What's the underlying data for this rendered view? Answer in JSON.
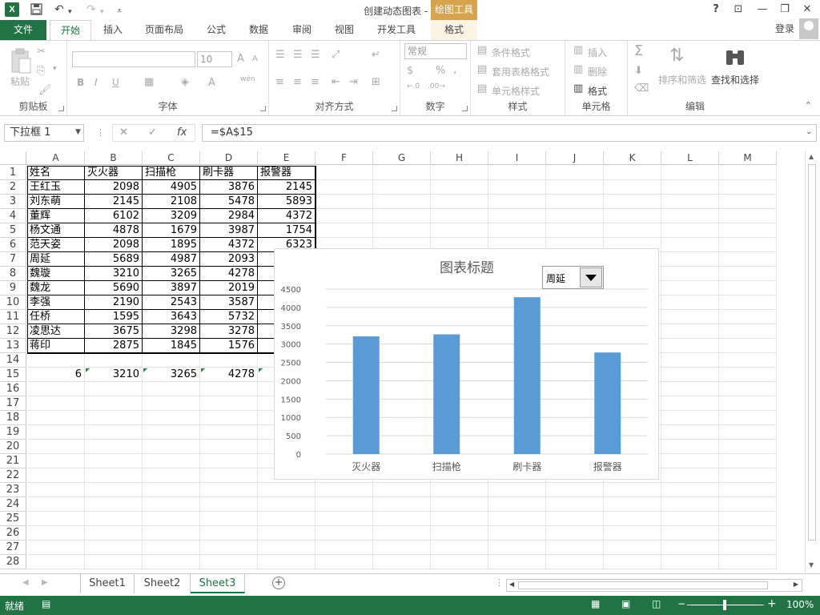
{
  "title": {
    "app_logo": "X",
    "window_title": "创建动态图表 - Excel",
    "context_tab_group": "绘图工具",
    "help": "?",
    "ribbon_options": "⊡",
    "minimize": "—",
    "restore": "❐",
    "close": "✕"
  },
  "quick_access": {
    "save_icon": "floppy-disk-icon",
    "undo": "↶",
    "redo": "↷",
    "customize": "⩡"
  },
  "tabs": [
    "文件",
    "开始",
    "插入",
    "页面布局",
    "公式",
    "数据",
    "审阅",
    "视图",
    "开发工具",
    "格式"
  ],
  "user": {
    "login": "登录"
  },
  "ribbon": {
    "clipboard": {
      "label": "剪贴板",
      "paste": "粘贴"
    },
    "font": {
      "label": "字体",
      "font_name": "",
      "font_size": "10",
      "bold": "B",
      "italic": "I",
      "underline": "U",
      "grow": "A",
      "shrink": "A",
      "font_color": "A",
      "phonetic": "wén"
    },
    "alignment": {
      "label": "对齐方式"
    },
    "number": {
      "label": "数字",
      "format": "常规",
      "percent": "%",
      "comma": ","
    },
    "styles": {
      "label": "样式",
      "conditional": "条件格式",
      "table": "套用表格格式",
      "cell_styles": "单元格样式"
    },
    "cells": {
      "label": "单元格",
      "insert": "插入",
      "delete": "删除",
      "format": "格式"
    },
    "editing": {
      "label": "编辑",
      "sort": "排序和筛选",
      "find": "查找和选择"
    }
  },
  "formula_bar": {
    "name_box": "下拉框 1",
    "fx": "fx",
    "formula": "=$A$15"
  },
  "columns": [
    "A",
    "B",
    "C",
    "D",
    "E",
    "F",
    "G",
    "H",
    "I",
    "J",
    "K",
    "L",
    "M"
  ],
  "rows": [
    "1",
    "2",
    "3",
    "4",
    "5",
    "6",
    "7",
    "8",
    "9",
    "10",
    "11",
    "12",
    "13",
    "14",
    "15",
    "16",
    "17",
    "18",
    "19",
    "20",
    "21",
    "22",
    "23",
    "24",
    "25",
    "26",
    "27",
    "28"
  ],
  "table": {
    "headers": [
      "姓名",
      "灭火器",
      "扫描枪",
      "刷卡器",
      "报警器"
    ],
    "rows": [
      [
        "王红玉",
        "2098",
        "4905",
        "3876",
        "2145"
      ],
      [
        "刘东萌",
        "2145",
        "2108",
        "5478",
        "5893"
      ],
      [
        "董辉",
        "6102",
        "3209",
        "2984",
        "4372"
      ],
      [
        "杨文通",
        "4878",
        "1679",
        "3987",
        "1754"
      ],
      [
        "范天姿",
        "2098",
        "1895",
        "4372",
        "6323"
      ],
      [
        "周延",
        "5689",
        "4987",
        "2093",
        ""
      ],
      [
        "魏璇",
        "3210",
        "3265",
        "4278",
        ""
      ],
      [
        "魏龙",
        "5690",
        "3897",
        "2019",
        ""
      ],
      [
        "李强",
        "2190",
        "2543",
        "3587",
        ""
      ],
      [
        "任桥",
        "1595",
        "3643",
        "5732",
        ""
      ],
      [
        "凌思达",
        "3675",
        "3298",
        "3278",
        ""
      ],
      [
        "蒋印",
        "2875",
        "1845",
        "1576",
        ""
      ]
    ],
    "row15": [
      "6",
      "3210",
      "3265",
      "4278"
    ]
  },
  "chart_data": {
    "type": "bar",
    "title": "图表标题",
    "categories": [
      "灭火器",
      "扫描枪",
      "刷卡器",
      "报警器"
    ],
    "series": [
      {
        "values": [
          3210,
          3265,
          4278,
          2770
        ]
      }
    ],
    "yticks": [
      "0",
      "500",
      "1000",
      "1500",
      "2000",
      "2500",
      "3000",
      "3500",
      "4000",
      "4500"
    ],
    "ylim": [
      0,
      4500
    ],
    "grid": true,
    "bar_color": "#5b9bd5",
    "dropdown_value": "周延"
  },
  "sheets": [
    "Sheet1",
    "Sheet2",
    "Sheet3"
  ],
  "status": {
    "ready": "就绪",
    "zoom": "100%"
  },
  "colors": {
    "excel_green": "#217346",
    "draw_tools": "#d6a44e"
  }
}
